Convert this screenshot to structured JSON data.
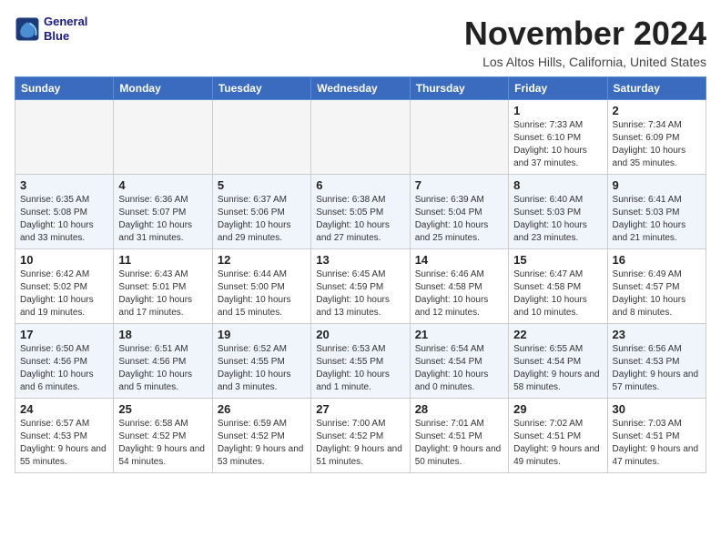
{
  "header": {
    "logo_line1": "General",
    "logo_line2": "Blue",
    "month": "November 2024",
    "location": "Los Altos Hills, California, United States"
  },
  "weekdays": [
    "Sunday",
    "Monday",
    "Tuesday",
    "Wednesday",
    "Thursday",
    "Friday",
    "Saturday"
  ],
  "weeks": [
    [
      {
        "day": "",
        "empty": true
      },
      {
        "day": "",
        "empty": true
      },
      {
        "day": "",
        "empty": true
      },
      {
        "day": "",
        "empty": true
      },
      {
        "day": "",
        "empty": true
      },
      {
        "day": "1",
        "sunrise": "Sunrise: 7:33 AM",
        "sunset": "Sunset: 6:10 PM",
        "daylight": "Daylight: 10 hours and 37 minutes."
      },
      {
        "day": "2",
        "sunrise": "Sunrise: 7:34 AM",
        "sunset": "Sunset: 6:09 PM",
        "daylight": "Daylight: 10 hours and 35 minutes."
      }
    ],
    [
      {
        "day": "3",
        "sunrise": "Sunrise: 6:35 AM",
        "sunset": "Sunset: 5:08 PM",
        "daylight": "Daylight: 10 hours and 33 minutes."
      },
      {
        "day": "4",
        "sunrise": "Sunrise: 6:36 AM",
        "sunset": "Sunset: 5:07 PM",
        "daylight": "Daylight: 10 hours and 31 minutes."
      },
      {
        "day": "5",
        "sunrise": "Sunrise: 6:37 AM",
        "sunset": "Sunset: 5:06 PM",
        "daylight": "Daylight: 10 hours and 29 minutes."
      },
      {
        "day": "6",
        "sunrise": "Sunrise: 6:38 AM",
        "sunset": "Sunset: 5:05 PM",
        "daylight": "Daylight: 10 hours and 27 minutes."
      },
      {
        "day": "7",
        "sunrise": "Sunrise: 6:39 AM",
        "sunset": "Sunset: 5:04 PM",
        "daylight": "Daylight: 10 hours and 25 minutes."
      },
      {
        "day": "8",
        "sunrise": "Sunrise: 6:40 AM",
        "sunset": "Sunset: 5:03 PM",
        "daylight": "Daylight: 10 hours and 23 minutes."
      },
      {
        "day": "9",
        "sunrise": "Sunrise: 6:41 AM",
        "sunset": "Sunset: 5:03 PM",
        "daylight": "Daylight: 10 hours and 21 minutes."
      }
    ],
    [
      {
        "day": "10",
        "sunrise": "Sunrise: 6:42 AM",
        "sunset": "Sunset: 5:02 PM",
        "daylight": "Daylight: 10 hours and 19 minutes."
      },
      {
        "day": "11",
        "sunrise": "Sunrise: 6:43 AM",
        "sunset": "Sunset: 5:01 PM",
        "daylight": "Daylight: 10 hours and 17 minutes."
      },
      {
        "day": "12",
        "sunrise": "Sunrise: 6:44 AM",
        "sunset": "Sunset: 5:00 PM",
        "daylight": "Daylight: 10 hours and 15 minutes."
      },
      {
        "day": "13",
        "sunrise": "Sunrise: 6:45 AM",
        "sunset": "Sunset: 4:59 PM",
        "daylight": "Daylight: 10 hours and 13 minutes."
      },
      {
        "day": "14",
        "sunrise": "Sunrise: 6:46 AM",
        "sunset": "Sunset: 4:58 PM",
        "daylight": "Daylight: 10 hours and 12 minutes."
      },
      {
        "day": "15",
        "sunrise": "Sunrise: 6:47 AM",
        "sunset": "Sunset: 4:58 PM",
        "daylight": "Daylight: 10 hours and 10 minutes."
      },
      {
        "day": "16",
        "sunrise": "Sunrise: 6:49 AM",
        "sunset": "Sunset: 4:57 PM",
        "daylight": "Daylight: 10 hours and 8 minutes."
      }
    ],
    [
      {
        "day": "17",
        "sunrise": "Sunrise: 6:50 AM",
        "sunset": "Sunset: 4:56 PM",
        "daylight": "Daylight: 10 hours and 6 minutes."
      },
      {
        "day": "18",
        "sunrise": "Sunrise: 6:51 AM",
        "sunset": "Sunset: 4:56 PM",
        "daylight": "Daylight: 10 hours and 5 minutes."
      },
      {
        "day": "19",
        "sunrise": "Sunrise: 6:52 AM",
        "sunset": "Sunset: 4:55 PM",
        "daylight": "Daylight: 10 hours and 3 minutes."
      },
      {
        "day": "20",
        "sunrise": "Sunrise: 6:53 AM",
        "sunset": "Sunset: 4:55 PM",
        "daylight": "Daylight: 10 hours and 1 minute."
      },
      {
        "day": "21",
        "sunrise": "Sunrise: 6:54 AM",
        "sunset": "Sunset: 4:54 PM",
        "daylight": "Daylight: 10 hours and 0 minutes."
      },
      {
        "day": "22",
        "sunrise": "Sunrise: 6:55 AM",
        "sunset": "Sunset: 4:54 PM",
        "daylight": "Daylight: 9 hours and 58 minutes."
      },
      {
        "day": "23",
        "sunrise": "Sunrise: 6:56 AM",
        "sunset": "Sunset: 4:53 PM",
        "daylight": "Daylight: 9 hours and 57 minutes."
      }
    ],
    [
      {
        "day": "24",
        "sunrise": "Sunrise: 6:57 AM",
        "sunset": "Sunset: 4:53 PM",
        "daylight": "Daylight: 9 hours and 55 minutes."
      },
      {
        "day": "25",
        "sunrise": "Sunrise: 6:58 AM",
        "sunset": "Sunset: 4:52 PM",
        "daylight": "Daylight: 9 hours and 54 minutes."
      },
      {
        "day": "26",
        "sunrise": "Sunrise: 6:59 AM",
        "sunset": "Sunset: 4:52 PM",
        "daylight": "Daylight: 9 hours and 53 minutes."
      },
      {
        "day": "27",
        "sunrise": "Sunrise: 7:00 AM",
        "sunset": "Sunset: 4:52 PM",
        "daylight": "Daylight: 9 hours and 51 minutes."
      },
      {
        "day": "28",
        "sunrise": "Sunrise: 7:01 AM",
        "sunset": "Sunset: 4:51 PM",
        "daylight": "Daylight: 9 hours and 50 minutes."
      },
      {
        "day": "29",
        "sunrise": "Sunrise: 7:02 AM",
        "sunset": "Sunset: 4:51 PM",
        "daylight": "Daylight: 9 hours and 49 minutes."
      },
      {
        "day": "30",
        "sunrise": "Sunrise: 7:03 AM",
        "sunset": "Sunset: 4:51 PM",
        "daylight": "Daylight: 9 hours and 47 minutes."
      }
    ]
  ]
}
